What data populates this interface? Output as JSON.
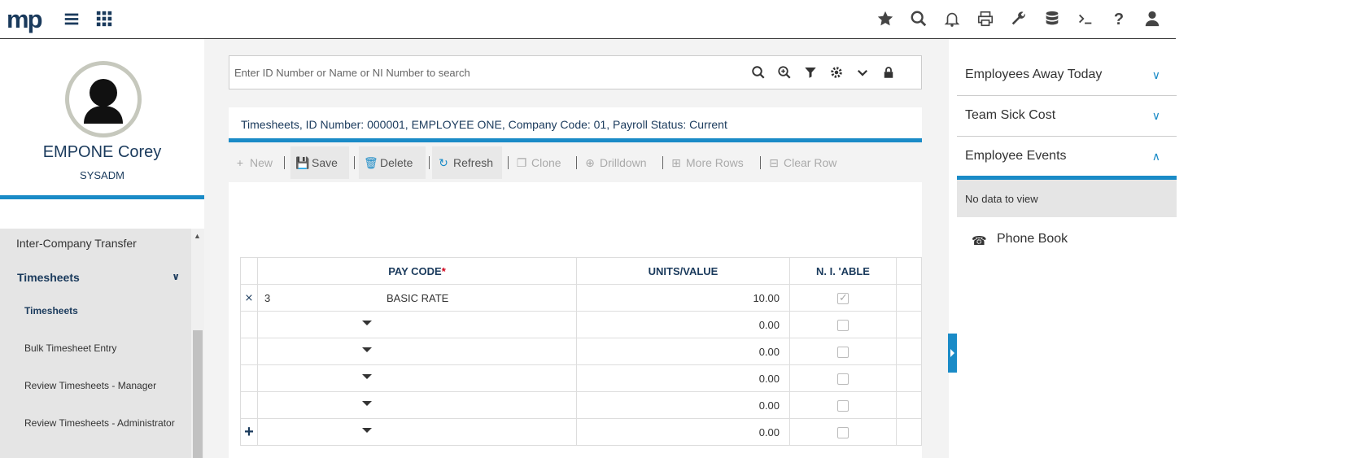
{
  "app": {
    "logo": "mp"
  },
  "topbar": {
    "icons": [
      "star-icon",
      "search-icon",
      "bell-icon",
      "printer-icon",
      "wrench-icon",
      "database-icon",
      "terminal-icon",
      "help-icon",
      "user-icon"
    ]
  },
  "user": {
    "name": "EMPONE Corey",
    "role": "SYSADM"
  },
  "nav": {
    "items": [
      {
        "label": "Inter-Company Transfer"
      },
      {
        "label": "Timesheets"
      },
      {
        "label": "Timesheets"
      },
      {
        "label": "Bulk Timesheet Entry"
      },
      {
        "label": "Review Timesheets - Manager"
      },
      {
        "label": "Review Timesheets - Administrator"
      }
    ]
  },
  "search": {
    "placeholder": "Enter ID Number or Name or NI Number to search"
  },
  "breadcrumb": "Timesheets, ID Number: 000001, EMPLOYEE ONE, Company Code: 01, Payroll Status: Current",
  "toolbar": {
    "new": "New",
    "save": "Save",
    "delete": "Delete",
    "refresh": "Refresh",
    "clone": "Clone",
    "drilldown": "Drilldown",
    "more_rows": "More Rows",
    "clear_row": "Clear Row"
  },
  "grid": {
    "headers": {
      "pay_code": "PAY CODE",
      "required_mark": "*",
      "units": "UNITS/VALUE",
      "nable": "N. I. 'ABLE"
    },
    "rows": [
      {
        "id": "3",
        "pay_code": "BASIC RATE",
        "units": "10.00",
        "nable": true
      },
      {
        "id": "",
        "pay_code": "",
        "units": "0.00",
        "nable": false
      },
      {
        "id": "",
        "pay_code": "",
        "units": "0.00",
        "nable": false
      },
      {
        "id": "",
        "pay_code": "",
        "units": "0.00",
        "nable": false
      },
      {
        "id": "",
        "pay_code": "",
        "units": "0.00",
        "nable": false
      },
      {
        "id": "",
        "pay_code": "",
        "units": "0.00",
        "nable": false
      }
    ]
  },
  "right": {
    "away": "Employees Away Today",
    "sick": "Team Sick Cost",
    "events": "Employee Events",
    "no_data": "No data to view",
    "phone_book": "Phone Book"
  },
  "colors": {
    "accent": "#1a8bc7",
    "navy": "#1a3a5c",
    "required": "#d0021b"
  }
}
